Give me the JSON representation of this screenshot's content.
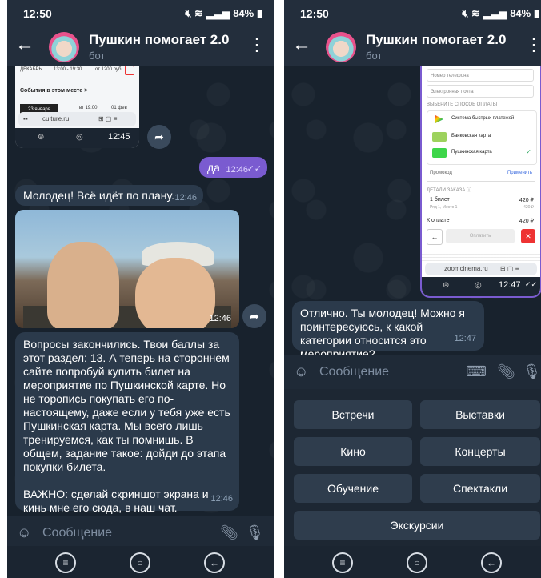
{
  "left": {
    "status": {
      "time": "12:50",
      "battery": "84%"
    },
    "header": {
      "title": "Пушкин помогает 2.0",
      "subtitle": "бот"
    },
    "screenshot_msg": {
      "date_label": "ДЕКАБРЬ",
      "time_range": "13:00 - 19:30",
      "price": "от 1200 руб",
      "events_label": "События в этом месте >",
      "row1_date": "23 января",
      "row1_time": "вт 19:00",
      "row1_right": "01 фев",
      "url": "culture.ru",
      "timestamp": "12:45"
    },
    "out_msg": {
      "text": "да",
      "time": "12:46"
    },
    "msg1": {
      "text": "Молодец! Всё идёт по плану.",
      "time": "12:46"
    },
    "photo_msg": {
      "time": "12:46"
    },
    "msg2": {
      "text": "Вопросы закончились. Твои баллы за этот раздел: 13. А теперь на стороннем сайте попробуй купить билет на мероприятие по Пушкинской карте. Но не торопись покупать его по-настоящему, даже если у тебя уже есть Пушкинская карта. Мы всего лишь тренируемся, как ты помнишь. В общем, задание такое: дойди до этапа покупки билета.",
      "text2": "ВАЖНО: сделай скриншот экрана и кинь мне его сюда, в наш чат.",
      "time": "12:46"
    },
    "input": {
      "placeholder": "Сообщение"
    }
  },
  "right": {
    "status": {
      "time": "12:50",
      "battery": "84%"
    },
    "header": {
      "title": "Пушкин помогает 2.0",
      "subtitle": "бот"
    },
    "screenshot_msg": {
      "phone_label": "Номер телефона",
      "email_label": "Электронная почта",
      "pay_heading": "ВЫБЕРИТЕ СПОСОБ ОПЛАТЫ",
      "pay1": "Система быстрых платежей",
      "pay2": "Банковская карта",
      "pay3": "Пушкинская карта",
      "promo": "Промокод",
      "apply": "Применить",
      "details": "ДЕТАЛИ ЗАКАЗА",
      "ticket": "1 билет",
      "ticket_price": "420 ₽",
      "seat": "Ряд 1, Место 1",
      "seat_price": "420 ₽",
      "total_label": "К оплате",
      "total": "420 ₽",
      "pay_button": "Оплатить",
      "url": "zoomcinema.ru",
      "timestamp": "12:47"
    },
    "msg1": {
      "text": "Отлично. Ты молодец! Можно я поинтересуюсь, к какой категории относится это мероприятие?",
      "time": "12:47"
    },
    "input": {
      "placeholder": "Сообщение"
    },
    "keyboard": [
      "Встречи",
      "Выставки",
      "Кино",
      "Концерты",
      "Обучение",
      "Спектакли",
      "Экскурсии"
    ]
  }
}
